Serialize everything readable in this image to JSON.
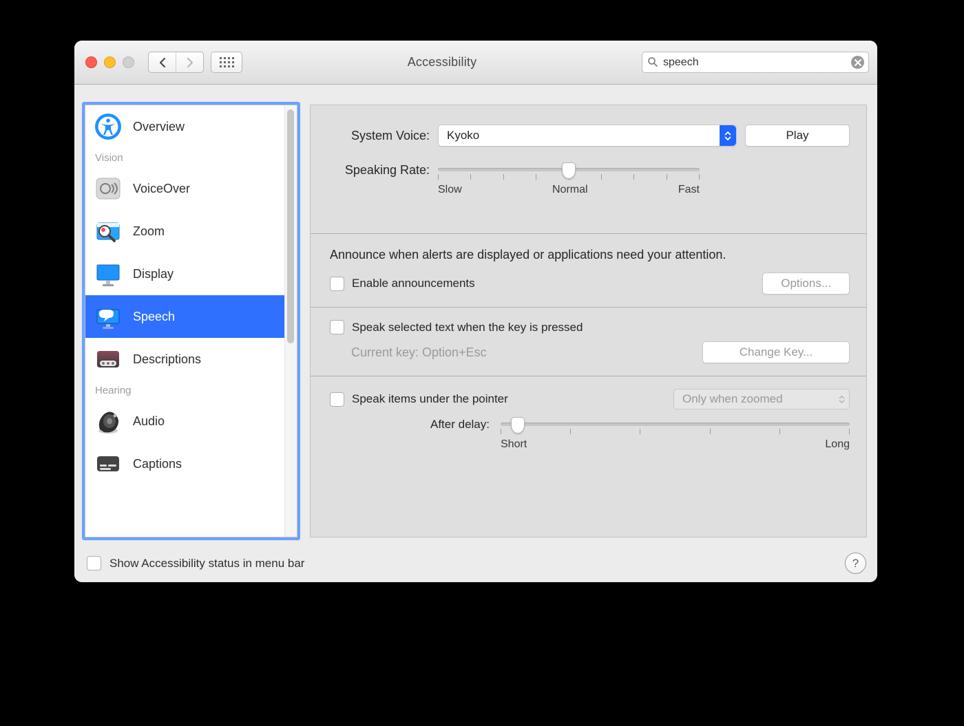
{
  "window": {
    "title": "Accessibility"
  },
  "search": {
    "value": "speech"
  },
  "sidebar": {
    "items": [
      {
        "label": "Overview",
        "kind": "item"
      },
      {
        "label": "Vision",
        "kind": "header"
      },
      {
        "label": "VoiceOver",
        "kind": "item"
      },
      {
        "label": "Zoom",
        "kind": "item"
      },
      {
        "label": "Display",
        "kind": "item"
      },
      {
        "label": "Speech",
        "kind": "item",
        "selected": true
      },
      {
        "label": "Descriptions",
        "kind": "item"
      },
      {
        "label": "Hearing",
        "kind": "header"
      },
      {
        "label": "Audio",
        "kind": "item"
      },
      {
        "label": "Captions",
        "kind": "item"
      }
    ]
  },
  "voice": {
    "label": "System Voice:",
    "value": "Kyoko",
    "play": "Play"
  },
  "rate": {
    "label": "Speaking Rate:",
    "marks": {
      "slow": "Slow",
      "normal": "Normal",
      "fast": "Fast"
    }
  },
  "announce": {
    "text": "Announce when alerts are displayed or applications need your attention.",
    "checkbox": "Enable announcements",
    "options": "Options..."
  },
  "speakSelected": {
    "checkbox": "Speak selected text when the key is pressed",
    "current": "Current key: Option+Esc",
    "change": "Change Key..."
  },
  "speakPointer": {
    "checkbox": "Speak items under the pointer",
    "mode": "Only when zoomed",
    "delayLabel": "After delay:",
    "short": "Short",
    "long": "Long"
  },
  "footer": {
    "checkbox": "Show Accessibility status in menu bar"
  }
}
